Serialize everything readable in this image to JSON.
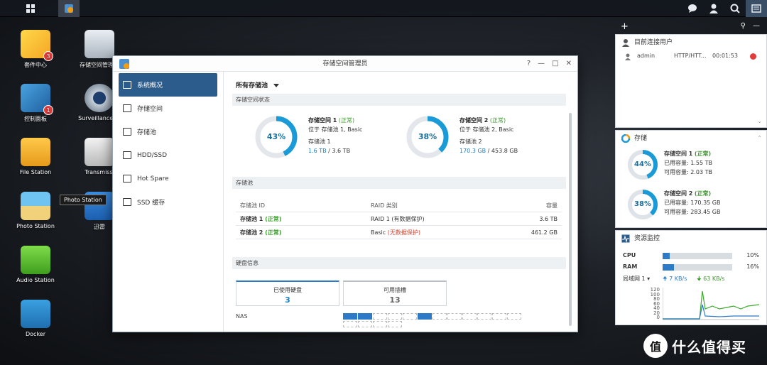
{
  "desktop": {
    "icons": [
      {
        "label": "套件中心",
        "badge": "3"
      },
      {
        "label": "存储空间管理员"
      },
      {
        "label": "控制面板",
        "badge": "1"
      },
      {
        "label": "Surveillance St"
      },
      {
        "label": "File Station"
      },
      {
        "label": "Transmissi"
      },
      {
        "label": "Photo Station"
      },
      {
        "label": "迅雷"
      },
      {
        "label": "Audio Station"
      },
      {
        "label": "Docker"
      }
    ],
    "tooltip": "Photo Station"
  },
  "window": {
    "title": "存储空间管理员",
    "controls": [
      "?",
      "—",
      "□",
      "✕"
    ],
    "sidebar": [
      {
        "label": "系统概况",
        "active": true
      },
      {
        "label": "存储空间"
      },
      {
        "label": "存储池"
      },
      {
        "label": "HDD/SSD"
      },
      {
        "label": "Hot Spare"
      },
      {
        "label": "SSD 缓存"
      }
    ],
    "selector": "所有存储池",
    "status_head": "存储空间状态",
    "volumes": [
      {
        "pct": "43%",
        "name": "存储空间 1",
        "status": "(正常)",
        "loc": "位于 存储池 1, Basic",
        "pool": "存储池 1",
        "used": "1.6 TB",
        "sep": " / ",
        "total": "3.6 TB"
      },
      {
        "pct": "38%",
        "name": "存储空间 2",
        "status": "(正常)",
        "loc": "位于 存储池 2, Basic",
        "pool": "存储池 2",
        "used": "170.3 GB",
        "sep": " / ",
        "total": "453.8 GB"
      }
    ],
    "pool_head": "存储池",
    "pool_table": {
      "headers": [
        "存储池 ID",
        "RAID 类别",
        "容量"
      ],
      "rows": [
        {
          "id": "存储池 1",
          "status": "(正常)",
          "raid": "RAID 1",
          "raid_note": "(有数据保护)",
          "cap": "3.6 TB"
        },
        {
          "id": "存储池 2",
          "status": "(正常)",
          "raid": "Basic",
          "raid_note": "(无数据保护)",
          "cap": "461.2 GB"
        }
      ]
    },
    "disk_head": "硬盘信息",
    "disk_cards": [
      {
        "label": "已使用硬盘",
        "value": "3"
      },
      {
        "label": "可用插槽",
        "value": "13"
      }
    ],
    "nas_label": "NAS",
    "slots_used": [
      0,
      1,
      5
    ],
    "slots_total": 16
  },
  "panel": {
    "users": {
      "title": "目前连接用户",
      "rows": [
        {
          "user": "admin",
          "proto": "HTTP/HTT...",
          "time": "00:01:53"
        }
      ]
    },
    "storage": {
      "title": "存储",
      "vols": [
        {
          "pct": "44%",
          "name": "存储空间 1",
          "status": "(正常)",
          "used_label": "已用容量:",
          "used": "1.55 TB",
          "free_label": "可用容量:",
          "free": "2.03 TB"
        },
        {
          "pct": "38%",
          "name": "存储空间 2",
          "status": "(正常)",
          "used_label": "已用容量:",
          "used": "170.35 GB",
          "free_label": "可用容量:",
          "free": "283.45 GB"
        }
      ]
    },
    "monitor": {
      "title": "资源监控",
      "cpu_label": "CPU",
      "cpu_pct": "10%",
      "cpu_value": 10,
      "ram_label": "RAM",
      "ram_pct": "16%",
      "ram_value": 16,
      "net_label": "局域网 1",
      "up": "7 KB/s",
      "down": "63 KB/s",
      "y_ticks": [
        "120",
        "100",
        "80",
        "60",
        "40",
        "20",
        "0"
      ]
    }
  },
  "watermark": {
    "logo": "值",
    "text": "什么值得买"
  },
  "colors": {
    "accent": "#2c5c8c",
    "ring": "#1a9ad6",
    "ok": "#3a9a2a",
    "warn": "#d0402f"
  }
}
